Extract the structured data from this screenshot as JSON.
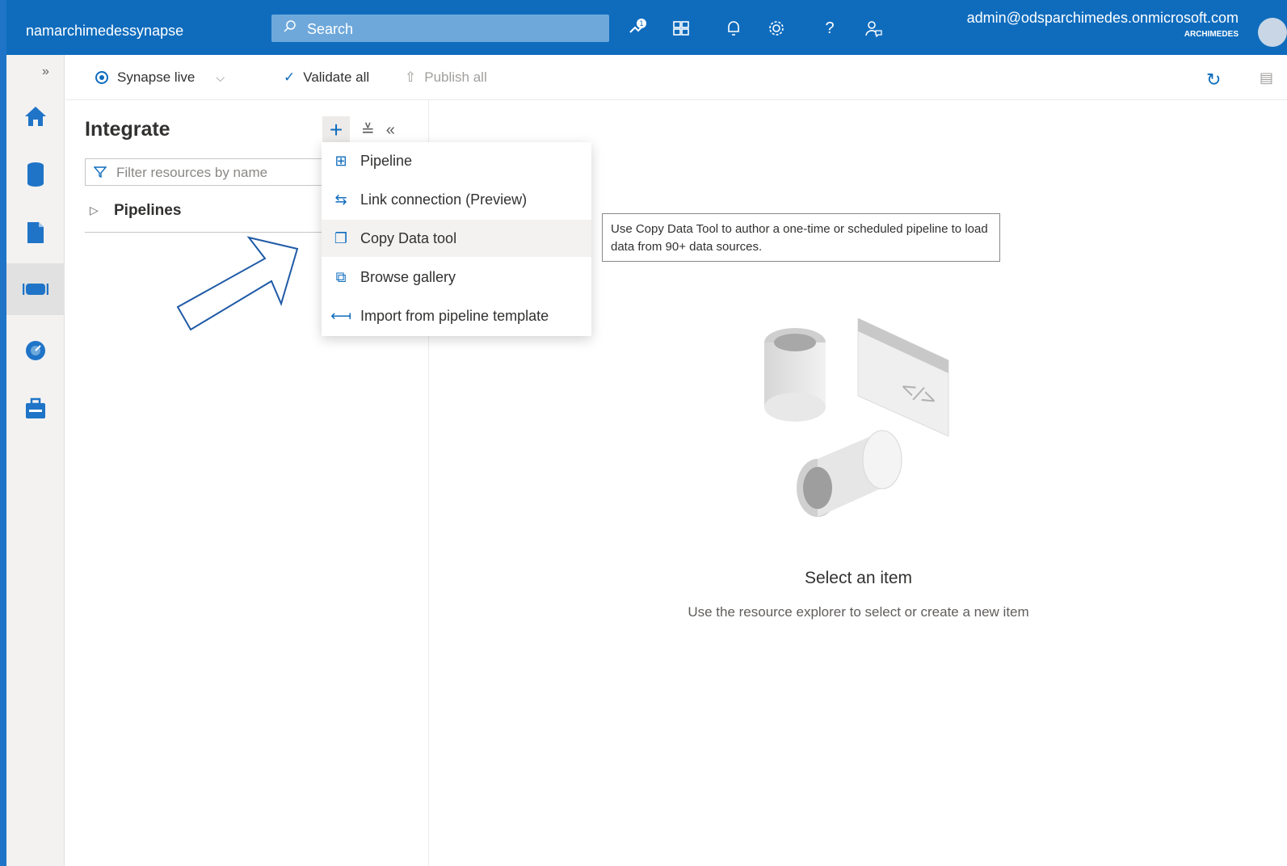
{
  "header": {
    "workspace": "namarchimedessynapse",
    "search_placeholder": "Search",
    "user_email": "admin@odsparchimedes.onmicrosoft.com",
    "user_org": "ARCHIMEDES"
  },
  "toolbar": {
    "mode_label": "Synapse live",
    "validate_label": "Validate all",
    "publish_label": "Publish all"
  },
  "panel": {
    "title": "Integrate",
    "filter_placeholder": "Filter resources by name",
    "tree_label": "Pipelines"
  },
  "menu": {
    "items": [
      {
        "label": "Pipeline",
        "icon": "pipeline-icon"
      },
      {
        "label": "Link connection (Preview)",
        "icon": "link-connection-icon"
      },
      {
        "label": "Copy Data tool",
        "icon": "copy-data-icon"
      },
      {
        "label": "Browse gallery",
        "icon": "gallery-icon"
      },
      {
        "label": "Import from pipeline template",
        "icon": "import-icon"
      }
    ]
  },
  "tooltip": {
    "text": "Use Copy Data Tool to author a one-time or scheduled pipeline to load data from 90+ data sources."
  },
  "empty_state": {
    "heading": "Select an item",
    "subtext": "Use the resource explorer to select or create a new item"
  },
  "colors": {
    "accent": "#0f6cbd",
    "frame": "#1f74c7"
  }
}
